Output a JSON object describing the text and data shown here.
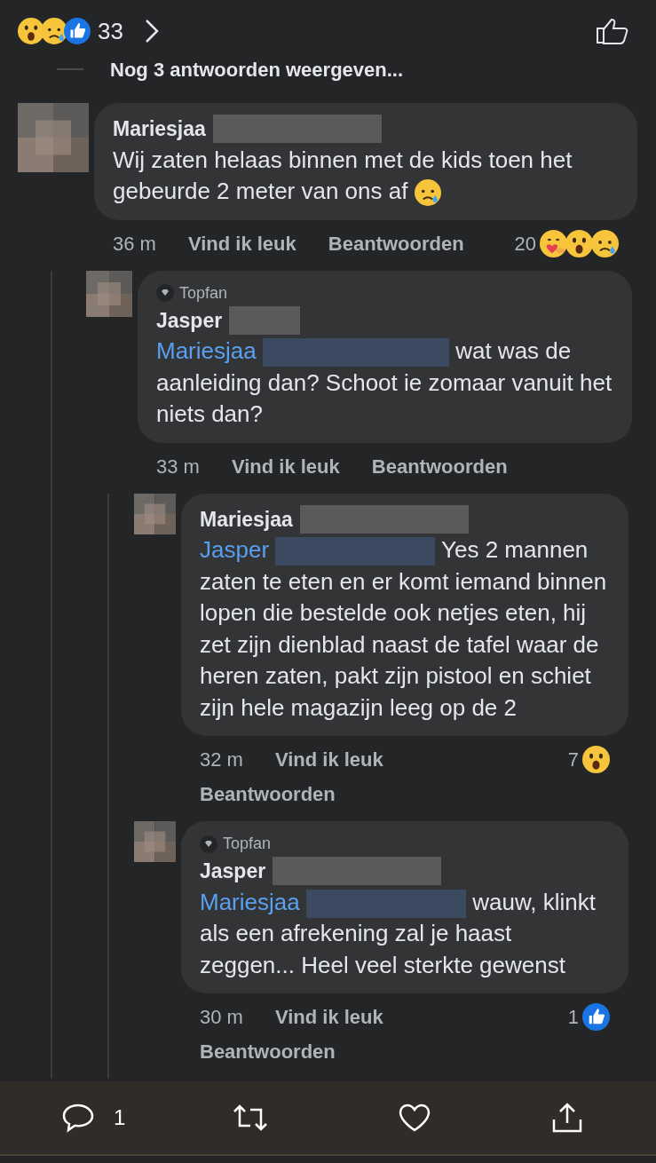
{
  "header": {
    "reactions": [
      {
        "kind": "wow"
      },
      {
        "kind": "sad"
      },
      {
        "kind": "like"
      }
    ],
    "reaction_count": "33",
    "more_replies": "Nog 3 antwoorden weergeven..."
  },
  "comments": [
    {
      "name": "Mariesjaa",
      "text": "Wij zaten helaas binnen met de kids toen het gebeurde 2 meter van ons af",
      "trailing_emoji": {
        "kind": "sad"
      },
      "time": "36 m",
      "like": "Vind ik leuk",
      "reply": "Beantwoorden",
      "reaction_count": "20",
      "reactions": [
        {
          "kind": "care"
        },
        {
          "kind": "wow"
        },
        {
          "kind": "sad"
        }
      ],
      "children": [
        {
          "badge": "Topfan",
          "name": "Jasper",
          "mention": "Mariesjaa",
          "text": "wat was de aanleiding dan? Schoot ie zomaar vanuit het niets dan?",
          "time": "33 m",
          "like": "Vind ik leuk",
          "reply": "Beantwoorden",
          "children": [
            {
              "name": "Mariesjaa",
              "mention": "Jasper",
              "text": "Yes 2 mannen zaten te eten en er komt iemand binnen lopen die bestelde ook netjes eten, hij zet zijn dienblad naast de tafel waar de heren zaten, pakt zijn pistool en schiet zijn hele magazijn leeg op de 2",
              "time": "32 m",
              "like": "Vind ik leuk",
              "reply": "Beantwoorden",
              "reaction_count": "7",
              "reactions": [
                {
                  "kind": "wow"
                }
              ]
            },
            {
              "badge": "Topfan",
              "name": "Jasper",
              "mention": "Mariesjaa",
              "text": "wauw, klinkt als een afrekening zal je haast zeggen... Heel veel sterkte gewenst",
              "time": "30 m",
              "like": "Vind ik leuk",
              "reply": "Beantwoorden",
              "reaction_count": "1",
              "reactions": [
                {
                  "kind": "like"
                }
              ]
            }
          ]
        }
      ]
    }
  ],
  "bottom_bar": {
    "comment_count": "1"
  }
}
